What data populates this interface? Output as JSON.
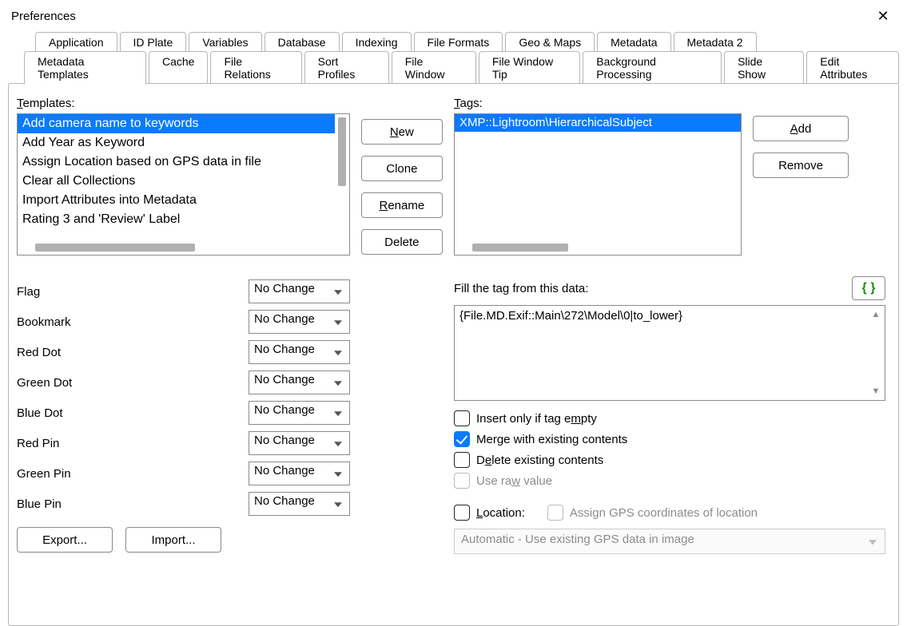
{
  "window": {
    "title": "Preferences"
  },
  "tabs_row1": [
    "Application",
    "ID Plate",
    "Variables",
    "Database",
    "Indexing",
    "File Formats",
    "Geo & Maps",
    "Metadata",
    "Metadata 2"
  ],
  "tabs_row2": [
    "Metadata Templates",
    "Cache",
    "File Relations",
    "Sort Profiles",
    "File Window",
    "File Window Tip",
    "Background Processing",
    "Slide Show",
    "Edit Attributes"
  ],
  "active_tab": "Metadata Templates",
  "templates_label": "emplates:",
  "templates_label_prefix": "T",
  "templates": [
    "Add camera name to keywords",
    "Add Year as Keyword",
    "Assign Location based on GPS data in file",
    "Clear all Collections",
    "Import Attributes into Metadata",
    "Rating 3 and 'Review' Label"
  ],
  "templates_selected_index": 0,
  "template_buttons": {
    "new": "ew",
    "new_prefix": "N",
    "clone": "Clone",
    "rename": "ename",
    "rename_prefix": "R",
    "delete": "Delete"
  },
  "props": [
    {
      "label": "Flag",
      "value": "No Change"
    },
    {
      "label": "Bookmark",
      "value": "No Change"
    },
    {
      "label": "Red Dot",
      "value": "No Change"
    },
    {
      "label": "Green Dot",
      "value": "No Change"
    },
    {
      "label": "Blue Dot",
      "value": "No Change"
    },
    {
      "label": "Red Pin",
      "value": "No Change"
    },
    {
      "label": "Green Pin",
      "value": "No Change"
    },
    {
      "label": "Blue Pin",
      "value": "No Change"
    }
  ],
  "export_label": "Export...",
  "import_label": "Import...",
  "tags_label": "ags:",
  "tags_label_prefix": "T",
  "tags": [
    "XMP::Lightroom\\HierarchicalSubject"
  ],
  "tags_selected_index": 0,
  "tag_buttons": {
    "add": "dd",
    "add_prefix": "A",
    "remove": "Remove"
  },
  "fill_label": "Fill the tag from this data:",
  "fill_value": "{File.MD.Exif::Main\\272\\Model\\0|to_lower}",
  "curly": "{ }",
  "checks": {
    "insert_empty": {
      "text_pre": "Insert only if tag e",
      "u": "m",
      "text_post": "pty",
      "checked": false,
      "disabled": false
    },
    "merge": {
      "text": "Merge with existing contents",
      "checked": true,
      "disabled": false
    },
    "delete_existing": {
      "text_pre": "D",
      "u": "e",
      "text_post": "lete existing contents",
      "checked": false,
      "disabled": false
    },
    "use_raw": {
      "text_pre": "Use ra",
      "u": "w",
      "text_post": " value",
      "checked": false,
      "disabled": true
    },
    "location": {
      "text_pre": "",
      "u": "L",
      "text_post": "ocation:",
      "checked": false,
      "disabled": false
    },
    "assign_gps": {
      "text": "Assign GPS coordinates of location",
      "checked": false,
      "disabled": true
    }
  },
  "location_combo": "Automatic -  Use existing GPS data in image"
}
